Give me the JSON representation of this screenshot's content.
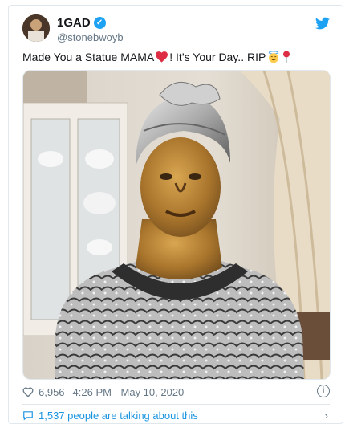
{
  "tweet": {
    "display_name": "1GAD",
    "handle": "@stonebwoyb",
    "text_part1": "Made You a Statue MAMA",
    "text_part2": "! It’s Your Day.. RIP",
    "likes": "6,956",
    "timestamp": "4:26 PM - May 10, 2020",
    "conversation": "1,537 people are talking about this"
  },
  "colors": {
    "twitter_blue": "#1da1f2",
    "link_blue": "#1b95e0",
    "muted": "#657786",
    "heart_red": "#e0245e"
  },
  "icons": {
    "verified": "verified-badge-icon",
    "brand": "twitter-bird-icon",
    "like": "heart-outline-icon",
    "info": "info-icon",
    "reply": "speech-bubble-icon"
  }
}
